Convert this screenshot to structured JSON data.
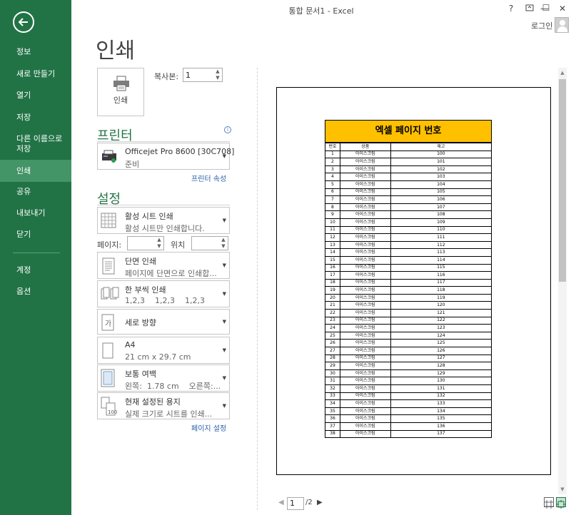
{
  "window": {
    "title": "통합 문서1 - Excel",
    "help": "?",
    "minimize": "—",
    "restore": "☐",
    "close": "✕",
    "login": "로그인"
  },
  "sidebar": {
    "items": [
      {
        "label": "정보"
      },
      {
        "label": "새로 만들기"
      },
      {
        "label": "열기"
      },
      {
        "label": "저장"
      },
      {
        "label": "다른 이름으로\n저장"
      },
      {
        "label": "인쇄"
      },
      {
        "label": "공유"
      },
      {
        "label": "내보내기"
      },
      {
        "label": "닫기"
      },
      {
        "label": "계정"
      },
      {
        "label": "옵션"
      }
    ],
    "active": "인쇄"
  },
  "print": {
    "title": "인쇄",
    "button_label": "인쇄",
    "copies_label": "복사본:",
    "copies_value": "1",
    "printer_title": "프린터",
    "printer_name": "Officejet Pro 8600 [30C708]",
    "printer_status": "준비",
    "printer_properties": "프린터 속성",
    "settings_title": "설정",
    "pages_label": "페이지:",
    "to_label": "위치",
    "page_setup_link": "페이지 설정",
    "settings": [
      {
        "icon": "grid-sheet-icon",
        "t1": "활성 시트 인쇄",
        "t2": "활성 시트만 인쇄합니다."
      },
      {
        "icon": "one-sided-icon",
        "t1": "단면 인쇄",
        "t2": "페이지에 단면으로 인쇄합..."
      },
      {
        "icon": "collated-icon",
        "t1": "한 부씩 인쇄",
        "t2": "1,2,3    1,2,3    1,2,3"
      },
      {
        "icon": "portrait-icon",
        "t1": "세로 방향",
        "t2": ""
      },
      {
        "icon": "paper-size-icon",
        "t1": "A4",
        "t2": "21 cm x 29.7 cm"
      },
      {
        "icon": "margins-icon",
        "t1": "보통 여백",
        "t2": "왼쪽:  1.78 cm    오른쪽:..."
      },
      {
        "icon": "scaling-icon",
        "t1": "현재 설정된 용지",
        "t2": "실제 크기로 시트를 인쇄..."
      }
    ]
  },
  "preview": {
    "sheet_title": "엑셀 페이지 번호",
    "headers": [
      "번호",
      "상품",
      "재고"
    ],
    "rows": [
      [
        "1",
        "아이스크림",
        "100"
      ],
      [
        "2",
        "아이스크림",
        "101"
      ],
      [
        "3",
        "아이스크림",
        "102"
      ],
      [
        "4",
        "아이스크림",
        "103"
      ],
      [
        "5",
        "아이스크림",
        "104"
      ],
      [
        "6",
        "아이스크림",
        "105"
      ],
      [
        "7",
        "아이스크림",
        "106"
      ],
      [
        "8",
        "아이스크림",
        "107"
      ],
      [
        "9",
        "아이스크림",
        "108"
      ],
      [
        "10",
        "아이스크림",
        "109"
      ],
      [
        "11",
        "아이스크림",
        "110"
      ],
      [
        "12",
        "아이스크림",
        "111"
      ],
      [
        "13",
        "아이스크림",
        "112"
      ],
      [
        "14",
        "아이스크림",
        "113"
      ],
      [
        "15",
        "아이스크림",
        "114"
      ],
      [
        "16",
        "아이스크림",
        "115"
      ],
      [
        "17",
        "아이스크림",
        "116"
      ],
      [
        "18",
        "아이스크림",
        "117"
      ],
      [
        "19",
        "아이스크림",
        "118"
      ],
      [
        "20",
        "아이스크림",
        "119"
      ],
      [
        "21",
        "아이스크림",
        "120"
      ],
      [
        "22",
        "아이스크림",
        "121"
      ],
      [
        "23",
        "아이스크림",
        "122"
      ],
      [
        "24",
        "아이스크림",
        "123"
      ],
      [
        "25",
        "아이스크림",
        "124"
      ],
      [
        "26",
        "아이스크림",
        "125"
      ],
      [
        "27",
        "아이스크림",
        "126"
      ],
      [
        "28",
        "아이스크림",
        "127"
      ],
      [
        "29",
        "아이스크림",
        "128"
      ],
      [
        "30",
        "아이스크림",
        "129"
      ],
      [
        "31",
        "아이스크림",
        "130"
      ],
      [
        "32",
        "아이스크림",
        "131"
      ],
      [
        "33",
        "아이스크림",
        "132"
      ],
      [
        "34",
        "아이스크림",
        "133"
      ],
      [
        "35",
        "아이스크림",
        "134"
      ],
      [
        "36",
        "아이스크림",
        "135"
      ],
      [
        "37",
        "아이스크림",
        "136"
      ],
      [
        "38",
        "아이스크림",
        "137"
      ]
    ],
    "current_page": "1",
    "total_pages": "/2"
  },
  "colors": {
    "accent": "#217346",
    "sheet_header": "#ffc000",
    "link": "#2a5ea9"
  }
}
